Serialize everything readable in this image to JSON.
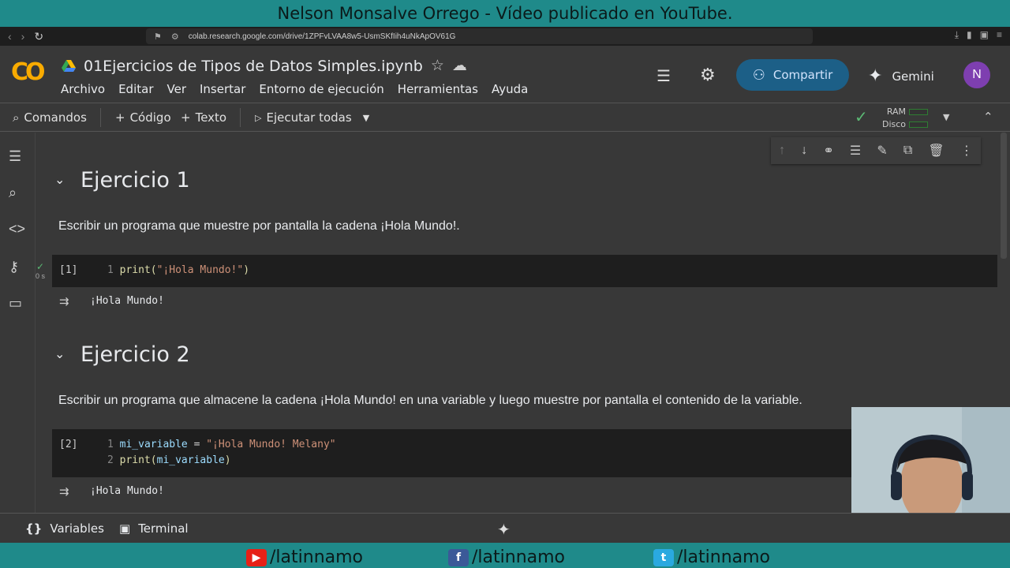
{
  "banner": {
    "text": "Nelson Monsalve Orrego - Vídeo publicado en YouTube."
  },
  "browser": {
    "url": "colab.research.google.com/drive/1ZPFvLVAA8w5-UsmSKfIih4uNkApOV61G"
  },
  "header": {
    "logo": "CO",
    "title": "01Ejercicios de Tipos de Datos Simples.ipynb",
    "share_label": "Compartir",
    "gemini_label": "Gemini",
    "avatar_letter": "N",
    "menu": [
      "Archivo",
      "Editar",
      "Ver",
      "Insertar",
      "Entorno de ejecución",
      "Herramientas",
      "Ayuda"
    ]
  },
  "toolbar": {
    "commands": "Comandos",
    "code": "Código",
    "text": "Texto",
    "run_all": "Ejecutar todas",
    "ram": "RAM",
    "disk": "Disco"
  },
  "notebook": {
    "ex1_title": "Ejercicio 1",
    "ex1_desc": "Escribir un programa que muestre por pantalla la cadena ¡Hola Mundo!.",
    "cell1_count": "[1]",
    "cell1_time": "0 s",
    "cell1_line_no": "1",
    "cell1_fn": "print",
    "cell1_str": "\"¡Hola Mundo!\"",
    "cell1_output": "¡Hola Mundo!",
    "ex2_title": "Ejercicio 2",
    "ex2_desc": "Escribir un programa que almacene la cadena ¡Hola Mundo! en una variable y luego muestre por pantalla el contenido de la variable.",
    "cell2_count": "[2]",
    "cell2_line1_no": "1",
    "cell2_line1_var": "mi_variable",
    "cell2_line1_eq": " = ",
    "cell2_line1_str": "\"¡Hola Mundo! Melany\"",
    "cell2_line2_no": "2",
    "cell2_line2_fn": "print",
    "cell2_line2_arg": "mi_variable",
    "cell2_output": "¡Hola Mundo!"
  },
  "bottom": {
    "variables": "Variables",
    "terminal": "Terminal"
  },
  "social": {
    "youtube": "/latinnamo",
    "facebook": "/latinnamo",
    "twitter": "/latinnamo"
  },
  "colors": {
    "share": "#1c5f87",
    "teal_banner": "#1f8a8a",
    "avatar": "#7e3fb0"
  }
}
